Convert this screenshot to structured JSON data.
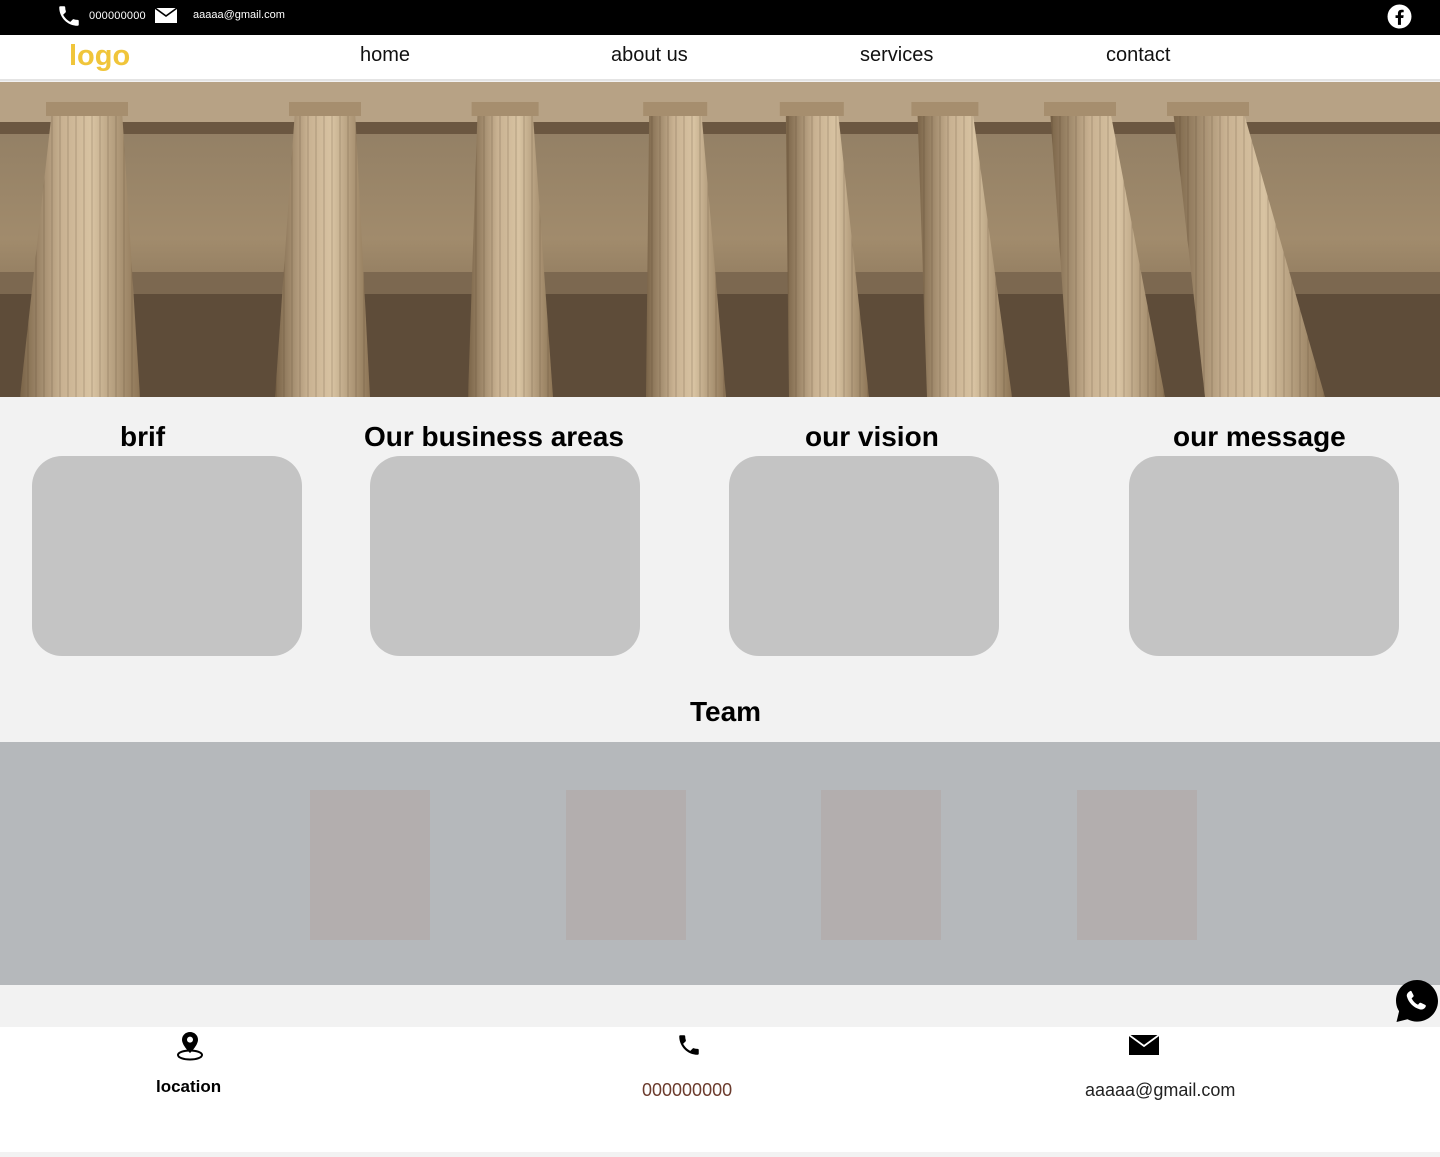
{
  "colors": {
    "topbar_bg": "#000000",
    "topbar_text": "#ffffff",
    "logo": "#f0c53a",
    "page_bg": "#f2f2f2",
    "card_bg": "#c4c4c4",
    "team_band_bg": "#b5b8bb",
    "member_bg": "#b3aeae",
    "footer_phone_text": "#6b3b2d"
  },
  "topbar": {
    "phone": "000000000",
    "email": "aaaaa@gmail.com",
    "icons": [
      "phone-icon",
      "mail-icon",
      "facebook-icon"
    ]
  },
  "nav": {
    "logo": "logo",
    "links": [
      "home",
      "about us",
      "services",
      "contact"
    ]
  },
  "hero": {
    "image": "building-colonnade-photo"
  },
  "sections": [
    {
      "title": "brif"
    },
    {
      "title": "Our business areas"
    },
    {
      "title": "our vision"
    },
    {
      "title": "our message"
    }
  ],
  "team": {
    "title": "Team",
    "member_count": 4
  },
  "footer": {
    "location_label": "location",
    "phone": "000000000",
    "email": "aaaaa@gmail.com",
    "icons": [
      "location-pin-icon",
      "phone-icon",
      "mail-icon",
      "whatsapp-icon"
    ]
  }
}
